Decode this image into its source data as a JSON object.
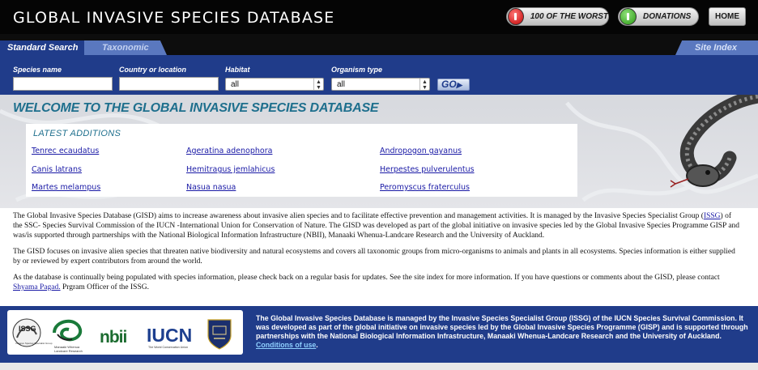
{
  "header": {
    "title": "GLOBAL INVASIVE SPECIES DATABASE",
    "buttons": {
      "worst": "100 OF THE WORST",
      "donations": "DONATIONS",
      "home": "HOME"
    }
  },
  "tabs": {
    "standard": "Standard Search",
    "taxonomic": "Taxonomic",
    "site_index": "Site Index"
  },
  "search": {
    "species_label": "Species name",
    "species_value": "",
    "country_label": "Country or location",
    "country_value": "",
    "habitat_label": "Habitat",
    "habitat_selected": "all",
    "organism_label": "Organism type",
    "organism_selected": "all",
    "go_label": "GO"
  },
  "welcome": "WELCOME TO THE GLOBAL INVASIVE SPECIES DATABASE",
  "latest": {
    "heading": "LATEST ADDITIONS",
    "items": [
      "Tenrec ecaudatus",
      "Ageratina adenophora",
      "Andropogon gayanus",
      "Canis latrans",
      "Hemitragus jemlahicus",
      "Herpestes pulverulentus",
      "Martes melampus",
      "Nasua nasua",
      "Peromyscus fraterculus"
    ]
  },
  "intro": {
    "p1_a": "The Global Invasive Species Database (GISD) aims to increase awareness about invasive alien species and to facilitate effective prevention and management activities. It is managed by the Invasive Species Specialist Group (",
    "p1_link": "ISSG",
    "p1_b": ") of the SSC- Species Survival Commission of the IUCN -International Union for Conservation of Nature. The GISD was developed as part of the global initiative on invasive species led by the Global Invasive Species Programme GISP and was/is supported through partnerships with the National Biological Information Infrastructure (NBII), Manaaki Whenua-Landcare Research and the University of Auckland.",
    "p2": "The GISD focuses on invasive alien species that threaten native biodiversity and natural ecosystems and covers all taxonomic groups from micro-organisms to animals and plants in all ecosystems. Species information is either supplied by or reviewed by expert contributors from around the world.",
    "p3_a": "As the database is continually being populated with species information, please check back on a regular basis for updates. See the site index for more information. If you have questions or comments about the GISD, please contact ",
    "p3_link": "Shyama Pagad.",
    "p3_b": " Prgram Officer of the ISSG."
  },
  "footer": {
    "logos": {
      "issg": "ISSG",
      "issg_sub": "Invasive Species Specialist Group",
      "manaaki": "Manaaki Whenua",
      "landcare": "Landcare Research",
      "nbii": "nbii",
      "iucn": "IUCN",
      "iucn_sub": "The World Conservation Union"
    },
    "text_a": "The Global Invasive Species Database is managed by the Invasive Species Specialist Group (ISSG) of the IUCN Species Survival Commission. It was developed as part of the global initiative on invasive species led by the Global Invasive Species Programme (GISP) and is supported through partnerships with the National Biological Information Infrastructure, Manaaki Whenua-Landcare Research and the University of Auckland. ",
    "text_link": "Conditions of use",
    "text_b": "."
  },
  "colors": {
    "nav_blue": "#203c8a",
    "teal_heading": "#1e6f8d",
    "link": "#1a1aa6",
    "header_black": "#050505"
  }
}
